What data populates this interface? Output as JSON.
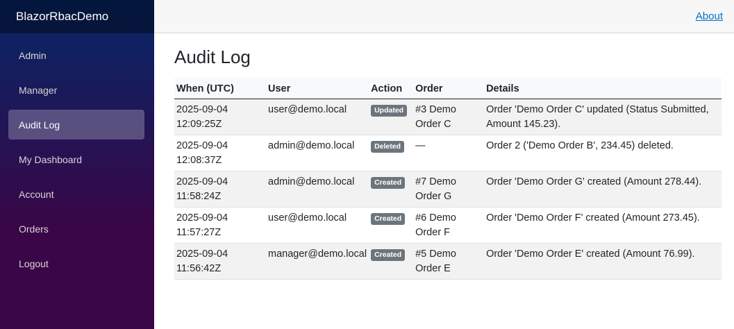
{
  "app": {
    "title": "BlazorRbacDemo"
  },
  "nav": {
    "items": [
      {
        "label": "Admin"
      },
      {
        "label": "Manager"
      },
      {
        "label": "Audit Log"
      },
      {
        "label": "My Dashboard"
      },
      {
        "label": "Account"
      },
      {
        "label": "Orders"
      },
      {
        "label": "Logout"
      }
    ]
  },
  "topbar": {
    "about_label": "About"
  },
  "page": {
    "title": "Audit Log"
  },
  "table": {
    "headers": [
      "When (UTC)",
      "User",
      "Action",
      "Order",
      "Details"
    ],
    "rows": [
      {
        "when_date": "2025-09-04",
        "when_time": "12:09:25Z",
        "user": "user@demo.local",
        "action": "Updated",
        "order_line1": "#3 Demo",
        "order_line2": "Order C",
        "details": "Order 'Demo Order C' updated (Status Submitted, Amount 145.23)."
      },
      {
        "when_date": "2025-09-04",
        "when_time": "12:08:37Z",
        "user": "admin@demo.local",
        "action": "Deleted",
        "order_line1": "—",
        "order_line2": "",
        "details": "Order 2 ('Demo Order B', 234.45) deleted."
      },
      {
        "when_date": "2025-09-04",
        "when_time": "11:58:24Z",
        "user": "admin@demo.local",
        "action": "Created",
        "order_line1": "#7 Demo",
        "order_line2": "Order G",
        "details": "Order 'Demo Order G' created (Amount 278.44)."
      },
      {
        "when_date": "2025-09-04",
        "when_time": "11:57:27Z",
        "user": "user@demo.local",
        "action": "Created",
        "order_line1": "#6 Demo",
        "order_line2": "Order F",
        "details": "Order 'Demo Order F' created (Amount 273.45)."
      },
      {
        "when_date": "2025-09-04",
        "when_time": "11:56:42Z",
        "user": "manager@demo.local",
        "action": "Created",
        "order_line1": "#5 Demo",
        "order_line2": "Order E",
        "details": "Order 'Demo Order E' created (Amount 76.99)."
      }
    ]
  },
  "colors": {
    "sidebar_top": "#052767",
    "sidebar_bottom": "#3a0647",
    "badge": "#6c757d",
    "link": "#0071c1"
  }
}
